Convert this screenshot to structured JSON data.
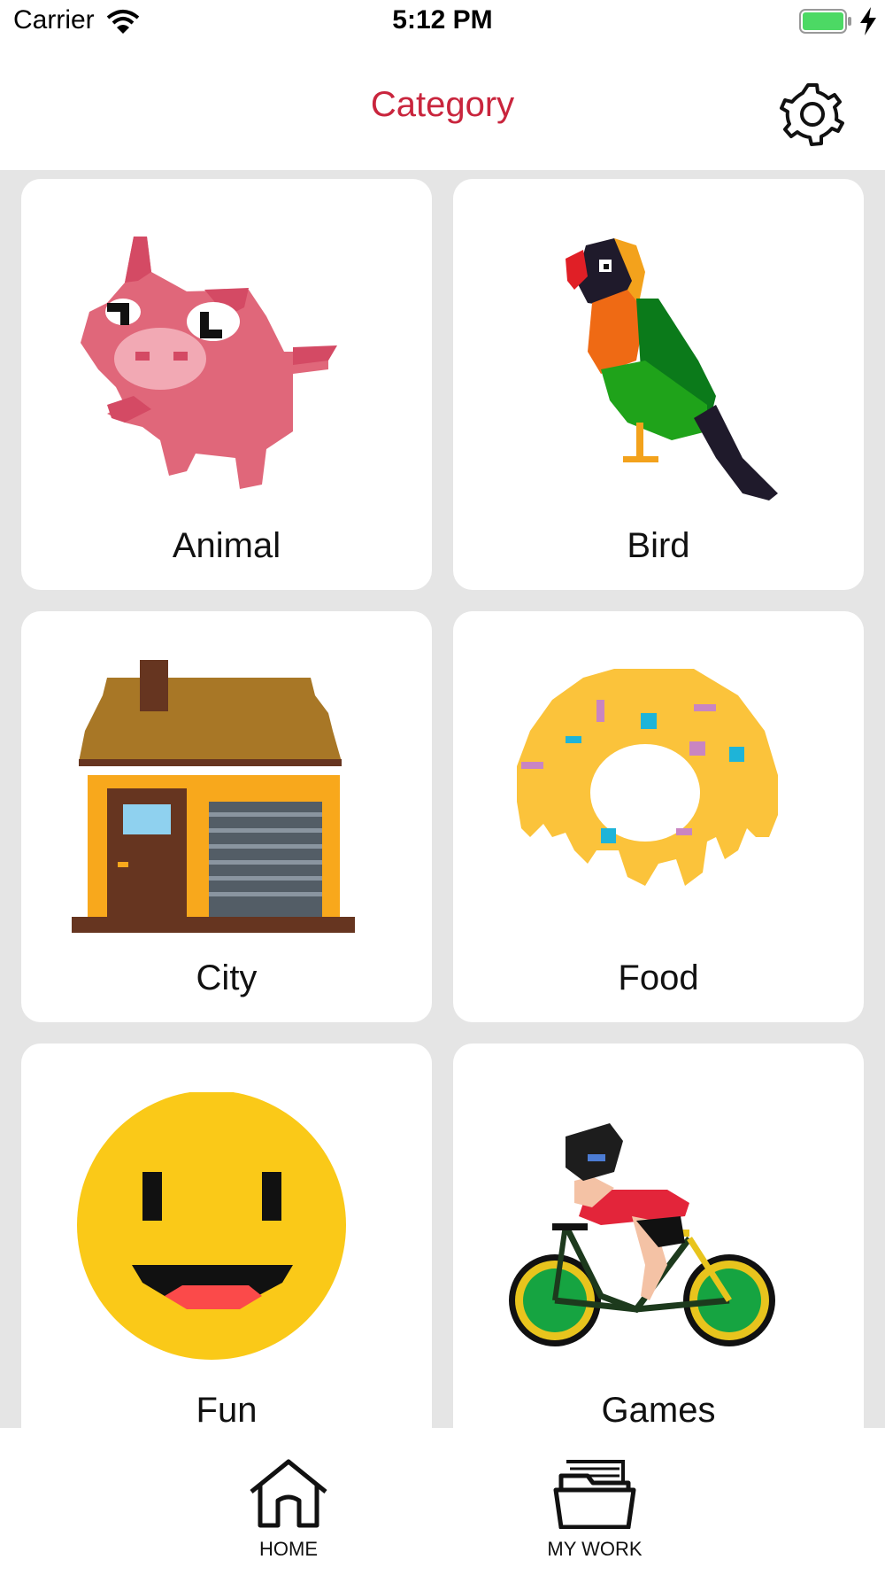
{
  "status_bar": {
    "carrier": "Carrier",
    "time": "5:12 PM"
  },
  "nav": {
    "title": "Category",
    "settings_icon": "gear-icon"
  },
  "categories": [
    {
      "label": "Animal"
    },
    {
      "label": "Bird"
    },
    {
      "label": "City"
    },
    {
      "label": "Food"
    },
    {
      "label": "Fun"
    },
    {
      "label": "Games"
    }
  ],
  "tabs": [
    {
      "label": "HOME",
      "icon": "home-icon"
    },
    {
      "label": "MY WORK",
      "icon": "folder-icon"
    }
  ],
  "colors": {
    "accent": "#c9253d",
    "background": "#e5e5e5",
    "card": "#ffffff",
    "battery": "#4cd964"
  }
}
